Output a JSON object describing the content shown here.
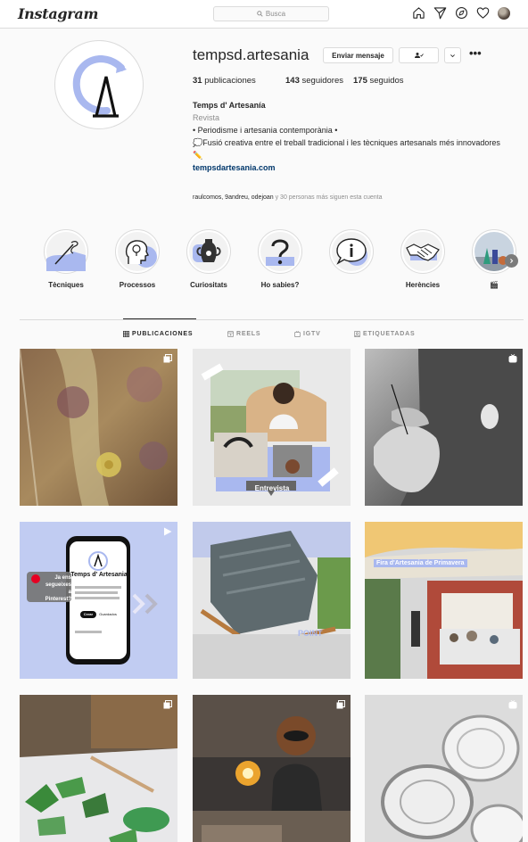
{
  "nav": {
    "logo": "Instagram",
    "search_placeholder": "Busca"
  },
  "profile": {
    "username": "tempsd.artesania",
    "message_button": "Enviar mensaje",
    "stats": {
      "posts_count": "31",
      "posts_label": "publicaciones",
      "followers_count": "143",
      "followers_label": "seguidores",
      "following_count": "175",
      "following_label": "seguidos"
    },
    "full_name": "Temps d' Artesanía",
    "category": "Revista",
    "bio_line1": "• Periodisme i artesania contemporània •",
    "bio_line2": "💭Fusió creativa entre el treball tradicional i les tècniques artesanals més innovadores",
    "bio_line3": "✏️",
    "website": "tempsdartesania.com",
    "followed_by_names": "raulcomos, 9andreu, odejoan",
    "followed_by_rest": " y 30 personas más siguen esta cuenta"
  },
  "highlights": [
    {
      "label": "Tècniques",
      "icon": "needle-icon"
    },
    {
      "label": "Processos",
      "icon": "head-bulb-icon"
    },
    {
      "label": "Curiositats",
      "icon": "vase-icon"
    },
    {
      "label": "Ho sabies?",
      "icon": "question-icon"
    },
    {
      "label": "",
      "icon": "info-bubble-icon"
    },
    {
      "label": "Herències",
      "icon": "handshake-icon"
    },
    {
      "label": "🎬",
      "icon": "clapper-icon"
    }
  ],
  "tabs": [
    {
      "label": "PUBLICACIONES",
      "icon": "grid-icon",
      "active": true
    },
    {
      "label": "REELS",
      "icon": "reels-icon",
      "active": false
    },
    {
      "label": "IGTV",
      "icon": "igtv-icon",
      "active": false
    },
    {
      "label": "ETIQUETADAS",
      "icon": "tagged-icon",
      "active": false
    }
  ],
  "posts": {
    "p2_caption": "Entrevista",
    "p4_pin_text": "Ja ens segueixes a Pinterest?",
    "p4_phone_title": "Temps d' Artesania",
    "p4_phone_btn1": "Crear",
    "p4_phone_btn2": "Guardados",
    "p5_caption": "POINT",
    "p6_caption": "Fira d'Artesania de Primavera"
  },
  "colors": {
    "accent_blue": "#a9b8ef",
    "link": "#00376b",
    "muted": "#8e8e8e",
    "border": "#dbdbdb"
  }
}
